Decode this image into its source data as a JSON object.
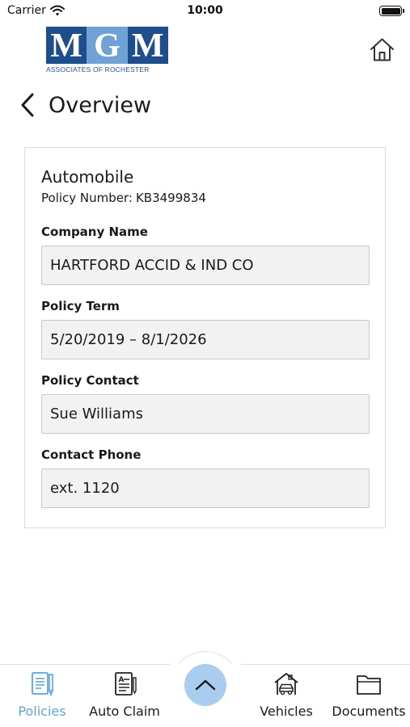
{
  "status_bar": {
    "carrier": "Carrier",
    "time": "10:00",
    "wifi_icon": "wifi-icon",
    "battery_icon": "battery-icon"
  },
  "header": {
    "logo": {
      "letters": [
        "M",
        "G",
        "M"
      ],
      "tagline": "ASSOCIATES OF ROCHESTER",
      "colors": {
        "dark": "#1f4e8c",
        "light": "#6fa3d6"
      }
    },
    "home_icon": "home-icon",
    "back_icon": "chevron-left-icon",
    "title": "Overview"
  },
  "policy": {
    "type": "Automobile",
    "number_label": "Policy Number:",
    "number_value": "KB3499834",
    "fields": [
      {
        "label": "Company Name",
        "value": "HARTFORD ACCID & IND CO"
      },
      {
        "label": "Policy Term",
        "value": "5/20/2019 – 8/1/2026"
      },
      {
        "label": "Policy Contact",
        "value": "Sue Williams"
      },
      {
        "label": "Contact Phone",
        "value": "ext. 1120"
      }
    ]
  },
  "tab_bar": {
    "tabs": [
      {
        "label": "Policies",
        "icon": "policy-document-icon",
        "active": true
      },
      {
        "label": "Auto Claim",
        "icon": "claim-form-icon",
        "active": false
      },
      {
        "label": "Vehicles",
        "icon": "car-garage-icon",
        "active": false
      },
      {
        "label": "Documents",
        "icon": "folder-icon",
        "active": false
      }
    ],
    "center_button_icon": "chevron-up-icon",
    "colors": {
      "active": "#5fa3d8",
      "center_button": "#a9cdee"
    }
  }
}
